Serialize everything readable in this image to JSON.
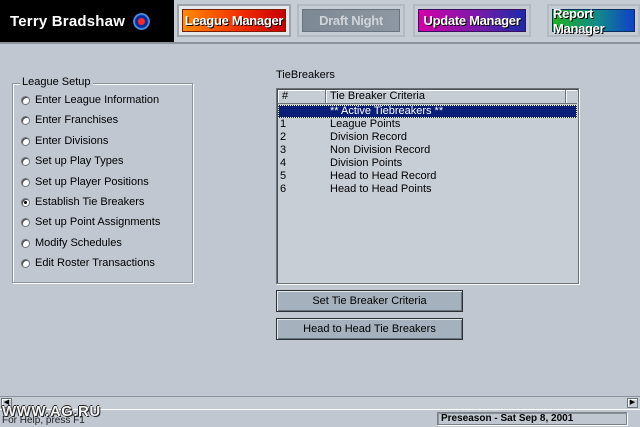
{
  "logo": {
    "name": "Terry Bradshaw"
  },
  "tabs": [
    {
      "label": "League Manager",
      "state": "active",
      "color": "#ee2a00"
    },
    {
      "label": "Draft Night",
      "state": "disabled",
      "color": "#7c8894"
    },
    {
      "label": "Update Manager",
      "state": "normal",
      "color": "#7a1aaa"
    },
    {
      "label": "Report Manager",
      "state": "normal",
      "color": "#118a8a"
    }
  ],
  "league_setup": {
    "title": "League Setup",
    "options": [
      {
        "label": "Enter League Information",
        "selected": false
      },
      {
        "label": "Enter Franchises",
        "selected": false
      },
      {
        "label": "Enter Divisions",
        "selected": false
      },
      {
        "label": "Set up Play Types",
        "selected": false
      },
      {
        "label": "Set up Player Positions",
        "selected": false
      },
      {
        "label": "Establish Tie Breakers",
        "selected": true
      },
      {
        "label": "Set up Point Assignments",
        "selected": false
      },
      {
        "label": "Modify Schedules",
        "selected": false
      },
      {
        "label": "Edit Roster Transactions",
        "selected": false
      }
    ]
  },
  "tiebreakers": {
    "title": "TieBreakers",
    "columns": [
      "#",
      "Tie Breaker Criteria"
    ],
    "rows": [
      {
        "num": "",
        "criteria": "** Active Tiebreakers **",
        "selected": true
      },
      {
        "num": "1",
        "criteria": "League Points"
      },
      {
        "num": "2",
        "criteria": "Division Record"
      },
      {
        "num": "3",
        "criteria": "Non Division Record"
      },
      {
        "num": "4",
        "criteria": "Division Points"
      },
      {
        "num": "5",
        "criteria": "Head to Head Record"
      },
      {
        "num": "6",
        "criteria": "Head to Head Points"
      }
    ]
  },
  "buttons": {
    "set_criteria": "Set Tie Breaker Criteria",
    "head_to_head": "Head to Head Tie Breakers"
  },
  "status": {
    "help": "For Help, press F1",
    "season": "Preseason  -  Sat Sep 8, 2001"
  },
  "watermark": "WWW.AG.RU",
  "colors": {
    "background": "#c0c7d0",
    "selection": "#0a1e78",
    "logo_bg": "#000000"
  }
}
